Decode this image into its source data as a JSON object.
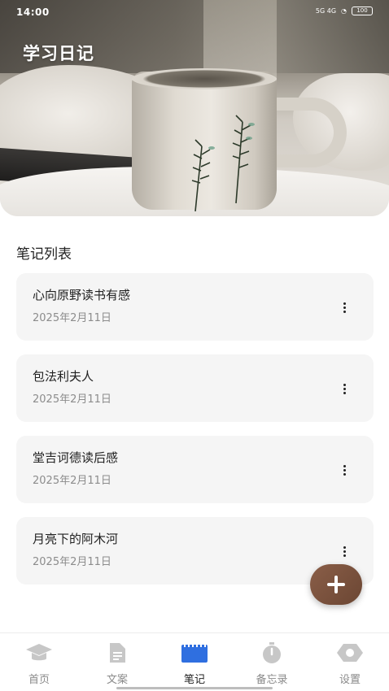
{
  "status_bar": {
    "time": "14:00",
    "network": "5G 4G",
    "battery": "100"
  },
  "header": {
    "title": "学习日记"
  },
  "section": {
    "title": "笔记列表"
  },
  "notes": [
    {
      "title": "心向原野读书有感",
      "date": "2025年2月11日"
    },
    {
      "title": "包法利夫人",
      "date": "2025年2月11日"
    },
    {
      "title": "堂吉诃德读后感",
      "date": "2025年2月11日"
    },
    {
      "title": "月亮下的阿木河",
      "date": "2025年2月11日"
    }
  ],
  "fab": {
    "icon": "plus-icon"
  },
  "tabbar": {
    "items": [
      {
        "label": "首页",
        "icon": "graduation-cap-icon",
        "active": false
      },
      {
        "label": "文案",
        "icon": "document-icon",
        "active": false
      },
      {
        "label": "笔记",
        "icon": "notebook-icon",
        "active": true
      },
      {
        "label": "备忘录",
        "icon": "stopwatch-icon",
        "active": false
      },
      {
        "label": "设置",
        "icon": "settings-icon",
        "active": false
      }
    ]
  },
  "colors": {
    "accent": "#2f6fe0",
    "fab": "#7a5240",
    "card_bg": "#f5f5f5",
    "inactive_icon": "#c7c7c7"
  }
}
